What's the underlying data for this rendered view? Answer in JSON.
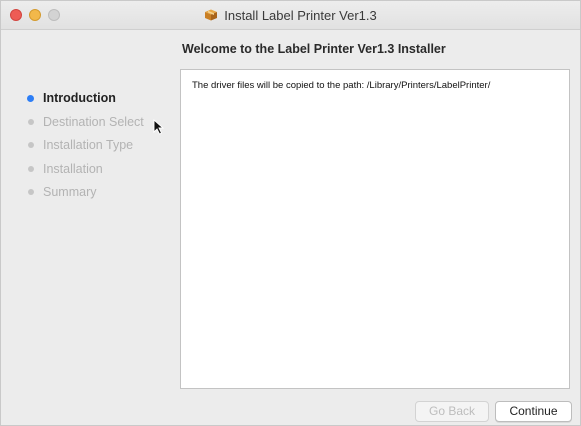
{
  "window": {
    "title": "Install Label Printer Ver1.3",
    "title_icon": "package-icon"
  },
  "main": {
    "heading": "Welcome to the Label Printer Ver1.3 Installer",
    "body_text": "The driver files will be copied to the path: /Library/Printers/LabelPrinter/"
  },
  "sidebar": {
    "steps": [
      {
        "label": "Introduction",
        "active": true
      },
      {
        "label": "Destination Select",
        "active": false
      },
      {
        "label": "Installation Type",
        "active": false
      },
      {
        "label": "Installation",
        "active": false
      },
      {
        "label": "Summary",
        "active": false
      }
    ]
  },
  "buttons": {
    "back_label": "Go Back",
    "back_enabled": false,
    "continue_label": "Continue"
  },
  "colors": {
    "accent": "#2d7ef6",
    "close": "#ee5c55",
    "minimize": "#f2b84a",
    "zoom_inactive": "#d3d3d3"
  }
}
